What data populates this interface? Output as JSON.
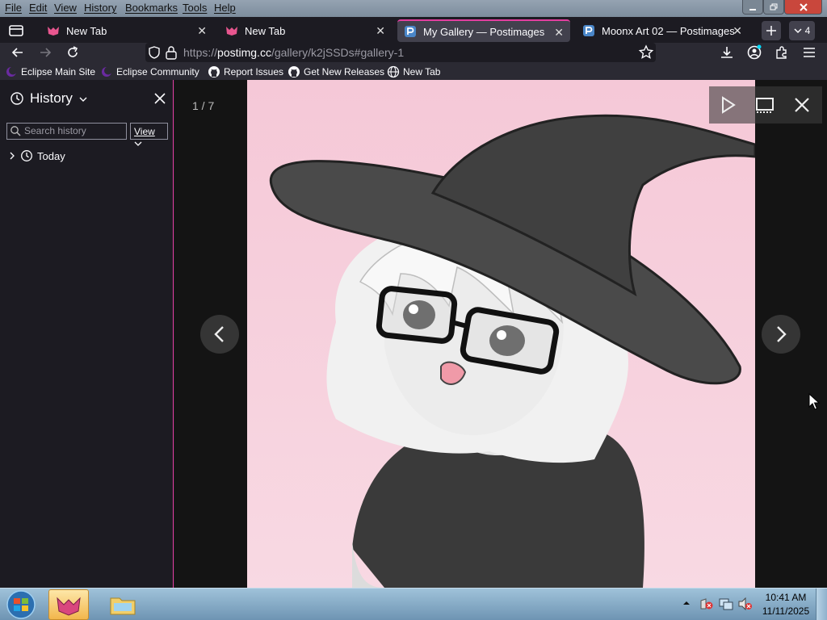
{
  "menu": [
    "File",
    "Edit",
    "View",
    "History",
    "Bookmarks",
    "Tools",
    "Help"
  ],
  "tabs": [
    {
      "title": "New Tab"
    },
    {
      "title": "New Tab"
    },
    {
      "title": "My Gallery — Postimages"
    },
    {
      "title": "Moonx Art 02 — Postimages"
    }
  ],
  "tab_count": "4",
  "url": {
    "prefix": "https://",
    "domain": "postimg.cc",
    "path": "/gallery/k2jSSDs#gallery-1"
  },
  "bookmarks": [
    "Eclipse Main Site",
    "Eclipse Community",
    "Report Issues",
    "Get New Releases",
    "New Tab"
  ],
  "sidebar": {
    "title": "History",
    "search_placeholder": "Search history",
    "view_label": "View",
    "group": "Today"
  },
  "viewer": {
    "counter": "1 / 7"
  },
  "clock": {
    "time": "10:41 AM",
    "date": "11/11/2025"
  },
  "colors": {
    "accent": "#e33ea0",
    "chrome_dark": "#1c1b22",
    "toolbar": "#2b2a33"
  }
}
